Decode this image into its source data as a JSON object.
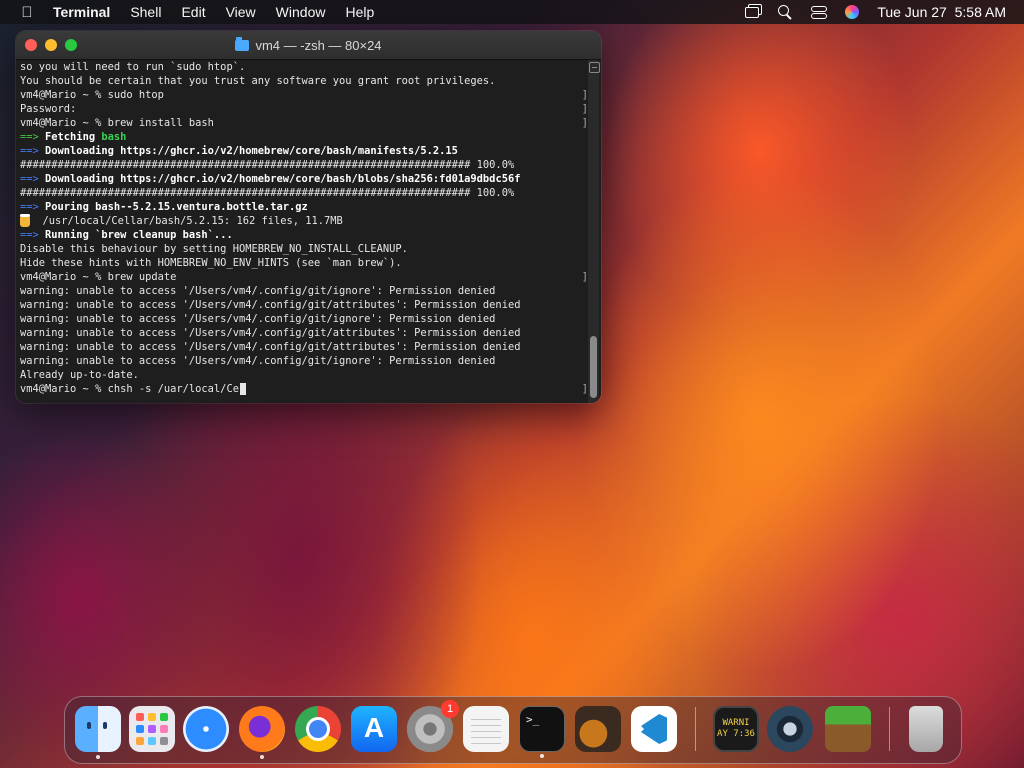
{
  "menubar": {
    "app_name": "Terminal",
    "menus": [
      "Shell",
      "Edit",
      "View",
      "Window",
      "Help"
    ],
    "clock": "Tue Jun 27  5:58 AM"
  },
  "terminal": {
    "title": "vm4 — -zsh — 80×24",
    "lines": [
      {
        "parts": [
          {
            "t": "so you will need to run `sudo htop`."
          }
        ]
      },
      {
        "parts": [
          {
            "t": "You should be certain that you trust any software you grant root privileges."
          }
        ]
      },
      {
        "parts": [
          {
            "t": "vm4@Mario ~ % sudo htop"
          }
        ],
        "mark": true
      },
      {
        "parts": [
          {
            "t": "Password:"
          }
        ],
        "mark": true
      },
      {
        "parts": [
          {
            "t": "vm4@Mario ~ % brew install bash"
          }
        ],
        "mark": true
      },
      {
        "parts": [
          {
            "t": "==> ",
            "c": "arrow-g"
          },
          {
            "t": "Fetching ",
            "c": "b"
          },
          {
            "t": "bash",
            "c": "green"
          }
        ]
      },
      {
        "parts": [
          {
            "t": "==> ",
            "c": "arrow-b"
          },
          {
            "t": "Downloading https://ghcr.io/v2/homebrew/core/bash/manifests/5.2.15",
            "c": "b"
          }
        ]
      },
      {
        "parts": [
          {
            "t": "######################################################################## 100.0%"
          }
        ]
      },
      {
        "parts": [
          {
            "t": "==> ",
            "c": "arrow-b"
          },
          {
            "t": "Downloading https://ghcr.io/v2/homebrew/core/bash/blobs/sha256:fd01a9dbdc56f",
            "c": "b"
          }
        ]
      },
      {
        "parts": [
          {
            "t": "######################################################################## 100.0%"
          }
        ]
      },
      {
        "parts": [
          {
            "t": "==> ",
            "c": "arrow-b"
          },
          {
            "t": "Pouring bash--5.2.15.ventura.bottle.tar.gz",
            "c": "b"
          }
        ]
      },
      {
        "parts": [
          {
            "t": "  /usr/local/Cellar/bash/5.2.15: 162 files, 11.7MB"
          }
        ],
        "beer": true
      },
      {
        "parts": [
          {
            "t": "==> ",
            "c": "arrow-b"
          },
          {
            "t": "Running `brew cleanup bash`...",
            "c": "b"
          }
        ]
      },
      {
        "parts": [
          {
            "t": "Disable this behaviour by setting HOMEBREW_NO_INSTALL_CLEANUP."
          }
        ]
      },
      {
        "parts": [
          {
            "t": "Hide these hints with HOMEBREW_NO_ENV_HINTS (see `man brew`)."
          }
        ]
      },
      {
        "parts": [
          {
            "t": "vm4@Mario ~ % brew update"
          }
        ],
        "mark": true
      },
      {
        "parts": [
          {
            "t": "warning: unable to access '/Users/vm4/.config/git/ignore': Permission denied"
          }
        ]
      },
      {
        "parts": [
          {
            "t": "warning: unable to access '/Users/vm4/.config/git/attributes': Permission denied"
          }
        ]
      },
      {
        "parts": [
          {
            "t": "warning: unable to access '/Users/vm4/.config/git/ignore': Permission denied"
          }
        ]
      },
      {
        "parts": [
          {
            "t": "warning: unable to access '/Users/vm4/.config/git/attributes': Permission denied"
          }
        ]
      },
      {
        "parts": [
          {
            "t": "warning: unable to access '/Users/vm4/.config/git/attributes': Permission denied"
          }
        ]
      },
      {
        "parts": [
          {
            "t": "warning: unable to access '/Users/vm4/.config/git/ignore': Permission denied"
          }
        ]
      },
      {
        "parts": [
          {
            "t": "Already up-to-date."
          }
        ]
      },
      {
        "parts": [
          {
            "t": "vm4@Mario ~ % chsh -s /uar/local/Ce"
          }
        ],
        "mark": true,
        "cursor": true
      }
    ]
  },
  "dock": {
    "settings_badge": "1",
    "console_text": [
      "WARNI",
      "AY 7:36"
    ],
    "apps": [
      "finder-icon",
      "launchpad-icon",
      "safari-icon",
      "firefox-icon",
      "chrome-icon",
      "app-store-icon",
      "system-settings-icon",
      "textedit-icon",
      "terminal-icon",
      "garageband-icon",
      "vscode-icon",
      "console-icon",
      "steam-icon",
      "minecraft-icon",
      "trash-icon"
    ]
  }
}
